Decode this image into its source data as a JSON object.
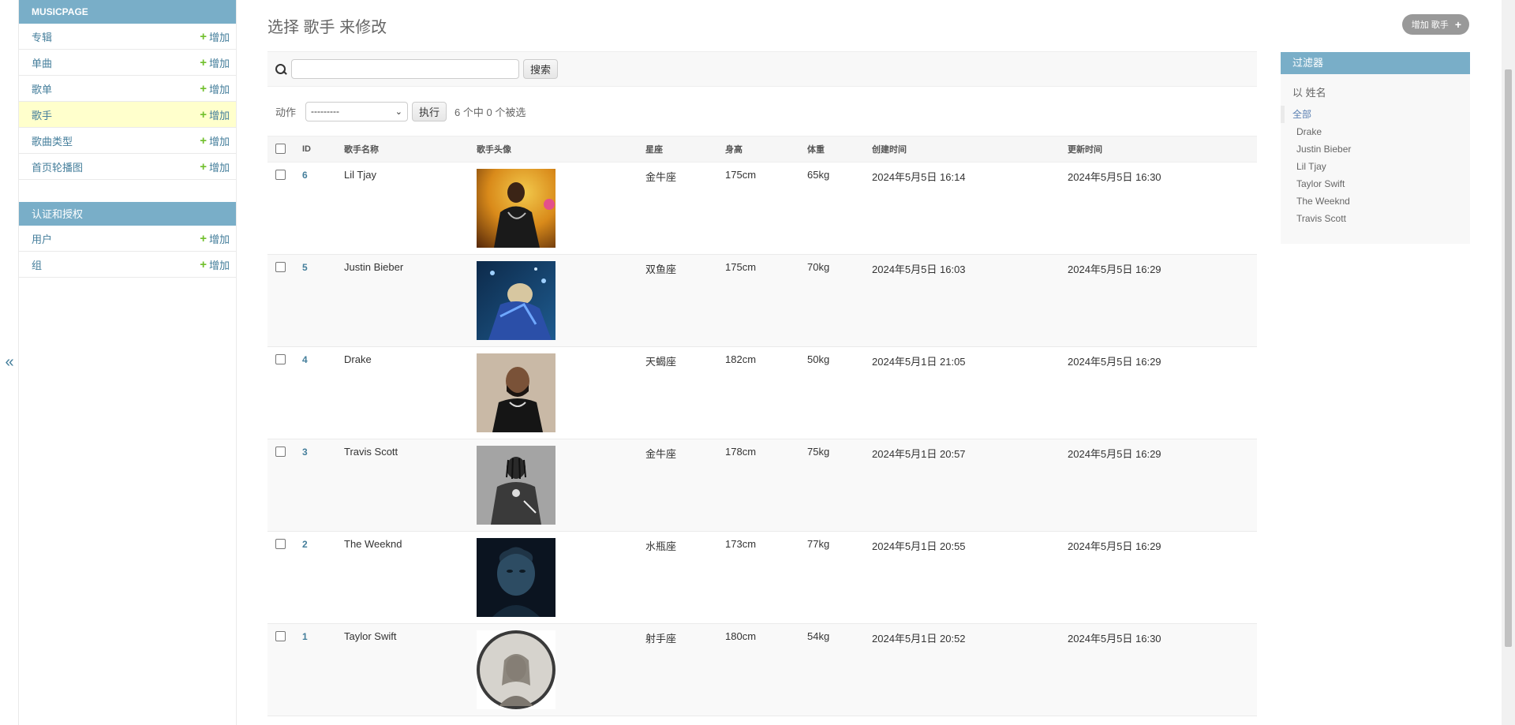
{
  "sidebar": {
    "modules": [
      {
        "caption": "MUSICPAGE",
        "rows": [
          {
            "label": "专辑",
            "add": "增加",
            "current": false
          },
          {
            "label": "单曲",
            "add": "增加",
            "current": false
          },
          {
            "label": "歌单",
            "add": "增加",
            "current": false
          },
          {
            "label": "歌手",
            "add": "增加",
            "current": true
          },
          {
            "label": "歌曲类型",
            "add": "增加",
            "current": false
          },
          {
            "label": "首页轮播图",
            "add": "增加",
            "current": false
          }
        ]
      },
      {
        "caption": "认证和授权",
        "rows": [
          {
            "label": "用户",
            "add": "增加",
            "current": false
          },
          {
            "label": "组",
            "add": "增加",
            "current": false
          }
        ]
      }
    ],
    "toggle": "«"
  },
  "page": {
    "title": "选择 歌手 来修改",
    "add_button": "增加 歌手"
  },
  "search": {
    "value": "",
    "button": "搜索"
  },
  "actions": {
    "label": "动作",
    "selected": "---------",
    "go": "执行",
    "counter": "6 个中 0 个被选"
  },
  "table": {
    "headers": [
      "ID",
      "歌手名称",
      "歌手头像",
      "星座",
      "身高",
      "体重",
      "创建时间",
      "更新时间"
    ],
    "rows": [
      {
        "id": "6",
        "name": "Lil Tjay",
        "avatar": "avatar-lil-tjay",
        "zodiac": "金牛座",
        "height": "175cm",
        "weight": "65kg",
        "created": "2024年5月5日 16:14",
        "updated": "2024年5月5日 16:30"
      },
      {
        "id": "5",
        "name": "Justin Bieber",
        "avatar": "avatar-justin-bieber",
        "zodiac": "双鱼座",
        "height": "175cm",
        "weight": "70kg",
        "created": "2024年5月5日 16:03",
        "updated": "2024年5月5日 16:29"
      },
      {
        "id": "4",
        "name": "Drake",
        "avatar": "avatar-drake",
        "zodiac": "天蝎座",
        "height": "182cm",
        "weight": "50kg",
        "created": "2024年5月1日 21:05",
        "updated": "2024年5月5日 16:29"
      },
      {
        "id": "3",
        "name": "Travis Scott",
        "avatar": "avatar-travis-scott",
        "zodiac": "金牛座",
        "height": "178cm",
        "weight": "75kg",
        "created": "2024年5月1日 20:57",
        "updated": "2024年5月5日 16:29"
      },
      {
        "id": "2",
        "name": "The Weeknd",
        "avatar": "avatar-the-weeknd",
        "zodiac": "水瓶座",
        "height": "173cm",
        "weight": "77kg",
        "created": "2024年5月1日 20:55",
        "updated": "2024年5月5日 16:29"
      },
      {
        "id": "1",
        "name": "Taylor Swift",
        "avatar": "avatar-taylor-swift",
        "zodiac": "射手座",
        "height": "180cm",
        "weight": "54kg",
        "created": "2024年5月1日 20:52",
        "updated": "2024年5月5日 16:30"
      }
    ]
  },
  "filter": {
    "title": "过滤器",
    "by": "以 姓名",
    "options": [
      "全部",
      "Drake",
      "Justin Bieber",
      "Lil Tjay",
      "Taylor Swift",
      "The Weeknd",
      "Travis Scott"
    ],
    "selected_index": 0
  },
  "colors": {
    "header_blue": "#79aec8",
    "link_blue": "#447e9b",
    "add_green": "#70bf2b",
    "current_row": "#ffffcc"
  }
}
